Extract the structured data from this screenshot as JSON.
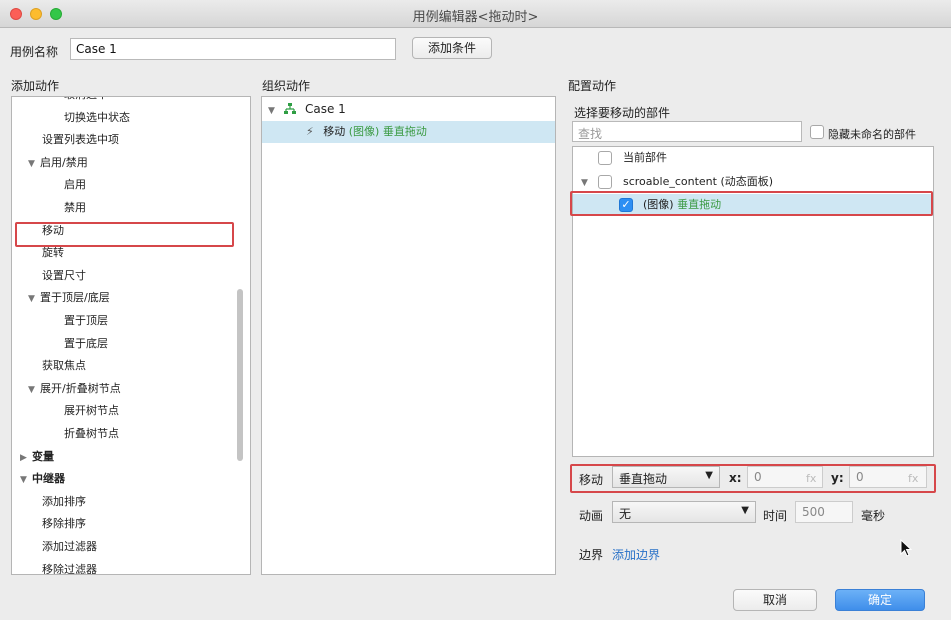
{
  "window": {
    "title": "用例编辑器<拖动时>"
  },
  "case_name": {
    "label": "用例名称",
    "value": "Case 1",
    "add_condition_button": "添加条件"
  },
  "headers": {
    "add_action": "添加动作",
    "organize_action": "组织动作",
    "configure_action": "配置动作"
  },
  "left_tree": [
    {
      "label": "取消选中",
      "indent": 2,
      "expand": ""
    },
    {
      "label": "切换选中状态",
      "indent": 2,
      "expand": ""
    },
    {
      "label": "设置列表选中项",
      "indent": 1,
      "expand": ""
    },
    {
      "label": "启用/禁用",
      "indent": 1,
      "expand": "▼"
    },
    {
      "label": "启用",
      "indent": 2,
      "expand": ""
    },
    {
      "label": "禁用",
      "indent": 2,
      "expand": ""
    },
    {
      "label": "移动",
      "indent": 1,
      "expand": ""
    },
    {
      "label": "旋转",
      "indent": 1,
      "expand": ""
    },
    {
      "label": "设置尺寸",
      "indent": 1,
      "expand": ""
    },
    {
      "label": "置于顶层/底层",
      "indent": 1,
      "expand": "▼"
    },
    {
      "label": "置于顶层",
      "indent": 2,
      "expand": ""
    },
    {
      "label": "置于底层",
      "indent": 2,
      "expand": ""
    },
    {
      "label": "获取焦点",
      "indent": 1,
      "expand": ""
    },
    {
      "label": "展开/折叠树节点",
      "indent": 1,
      "expand": "▼"
    },
    {
      "label": "展开树节点",
      "indent": 2,
      "expand": ""
    },
    {
      "label": "折叠树节点",
      "indent": 2,
      "expand": ""
    },
    {
      "label": "变量",
      "indent": 0,
      "expand": "▶"
    },
    {
      "label": "中继器",
      "indent": 0,
      "expand": "▼"
    },
    {
      "label": "添加排序",
      "indent": 1,
      "expand": ""
    },
    {
      "label": "移除排序",
      "indent": 1,
      "expand": ""
    },
    {
      "label": "添加过滤器",
      "indent": 1,
      "expand": ""
    },
    {
      "label": "移除过滤器",
      "indent": 1,
      "expand": ""
    }
  ],
  "middle_tree": {
    "case_label": "Case 1",
    "action_prefix": "移动",
    "action_target": "(图像)",
    "action_detail": "垂直拖动"
  },
  "config": {
    "select_widget_label": "选择要移动的部件",
    "search_placeholder": "查找",
    "hide_unnamed_label": "隐藏未命名的部件",
    "widget_items": {
      "current": "当前部件",
      "dynamic_panel": "scroable_content (动态面板)",
      "image_prefix": "(图像)",
      "image_name": "垂直拖动"
    },
    "move_label": "移动",
    "move_mode": "垂直拖动",
    "x_label": "x:",
    "x_value": "0",
    "y_label": "y:",
    "y_value": "0",
    "fx": "fx",
    "animation_label": "动画",
    "animation_value": "无",
    "time_label": "时间",
    "time_value": "500",
    "time_unit": "毫秒",
    "boundary_label": "边界",
    "add_boundary": "添加边界"
  },
  "footer": {
    "cancel": "取消",
    "ok": "确定"
  },
  "colors": {
    "selection": "#cfe7f3",
    "highlight_border": "#d6474a",
    "primary_button": "#4c9cf0",
    "green_text": "#3a9a42",
    "link_blue": "#2a72c8"
  }
}
